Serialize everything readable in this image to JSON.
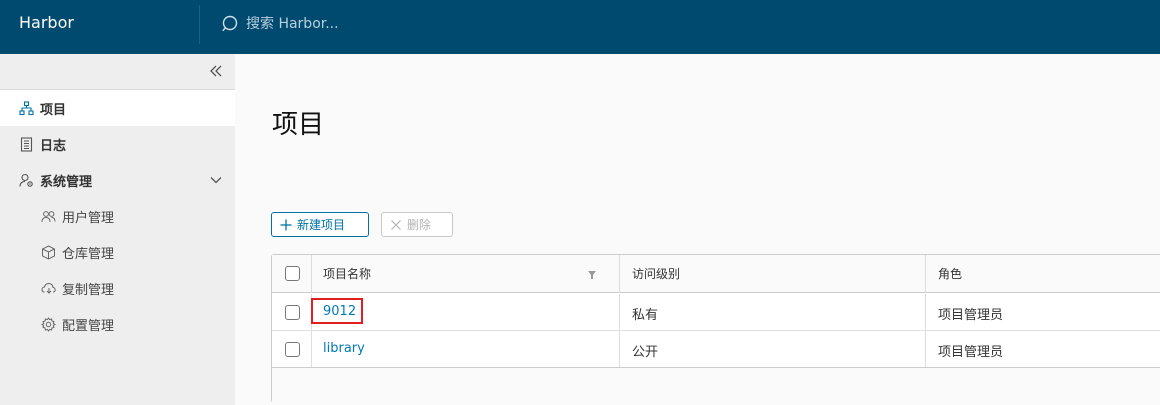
{
  "header": {
    "brand": "Harbor",
    "search_placeholder": "搜索 Harbor..."
  },
  "sidebar": {
    "items": [
      {
        "label": "项目",
        "icon": "organization-icon",
        "active": true
      },
      {
        "label": "日志",
        "icon": "log-document-icon",
        "active": false
      },
      {
        "label": "系统管理",
        "icon": "user-admin-icon",
        "active": false,
        "expanded": true
      }
    ],
    "sub_items": [
      {
        "label": "用户管理",
        "icon": "users-icon"
      },
      {
        "label": "仓库管理",
        "icon": "box-icon"
      },
      {
        "label": "复制管理",
        "icon": "cloud-sync-icon"
      },
      {
        "label": "配置管理",
        "icon": "settings-icon"
      }
    ]
  },
  "main": {
    "title": "项目",
    "new_button": "新建项目",
    "delete_button": "删除"
  },
  "table": {
    "columns": [
      "项目名称",
      "访问级别",
      "角色"
    ],
    "rows": [
      {
        "name": "9012",
        "access": "私有",
        "role": "项目管理员"
      },
      {
        "name": "library",
        "access": "公开",
        "role": "项目管理员"
      }
    ]
  },
  "colors": {
    "header_bg": "#004a70",
    "link": "#0079b8",
    "highlight": "#e02020"
  }
}
